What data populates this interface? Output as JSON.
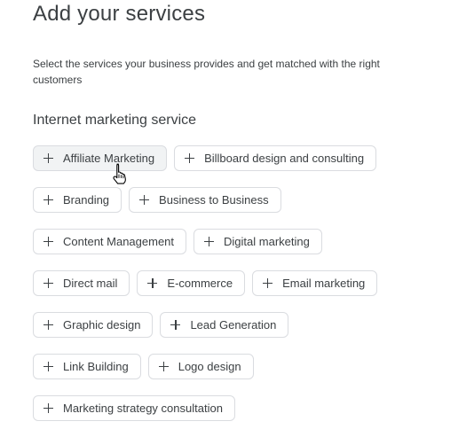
{
  "header": {
    "title": "Add your services",
    "description": "Select the services your business provides and get matched with the right customers"
  },
  "section": {
    "title": "Internet marketing service"
  },
  "services": [
    [
      "Affiliate Marketing",
      "Billboard design and consulting"
    ],
    [
      "Branding",
      "Business to Business"
    ],
    [
      "Content Management",
      "Digital marketing"
    ],
    [
      "Direct mail",
      "E-commerce",
      "Email marketing"
    ],
    [
      "Graphic design",
      "Lead Generation"
    ],
    [
      "Link Building",
      "Logo design"
    ],
    [
      "Marketing strategy consultation"
    ]
  ],
  "icons": {
    "chip_icon": "plus-icon",
    "cursor": "hand-pointer-cursor"
  }
}
